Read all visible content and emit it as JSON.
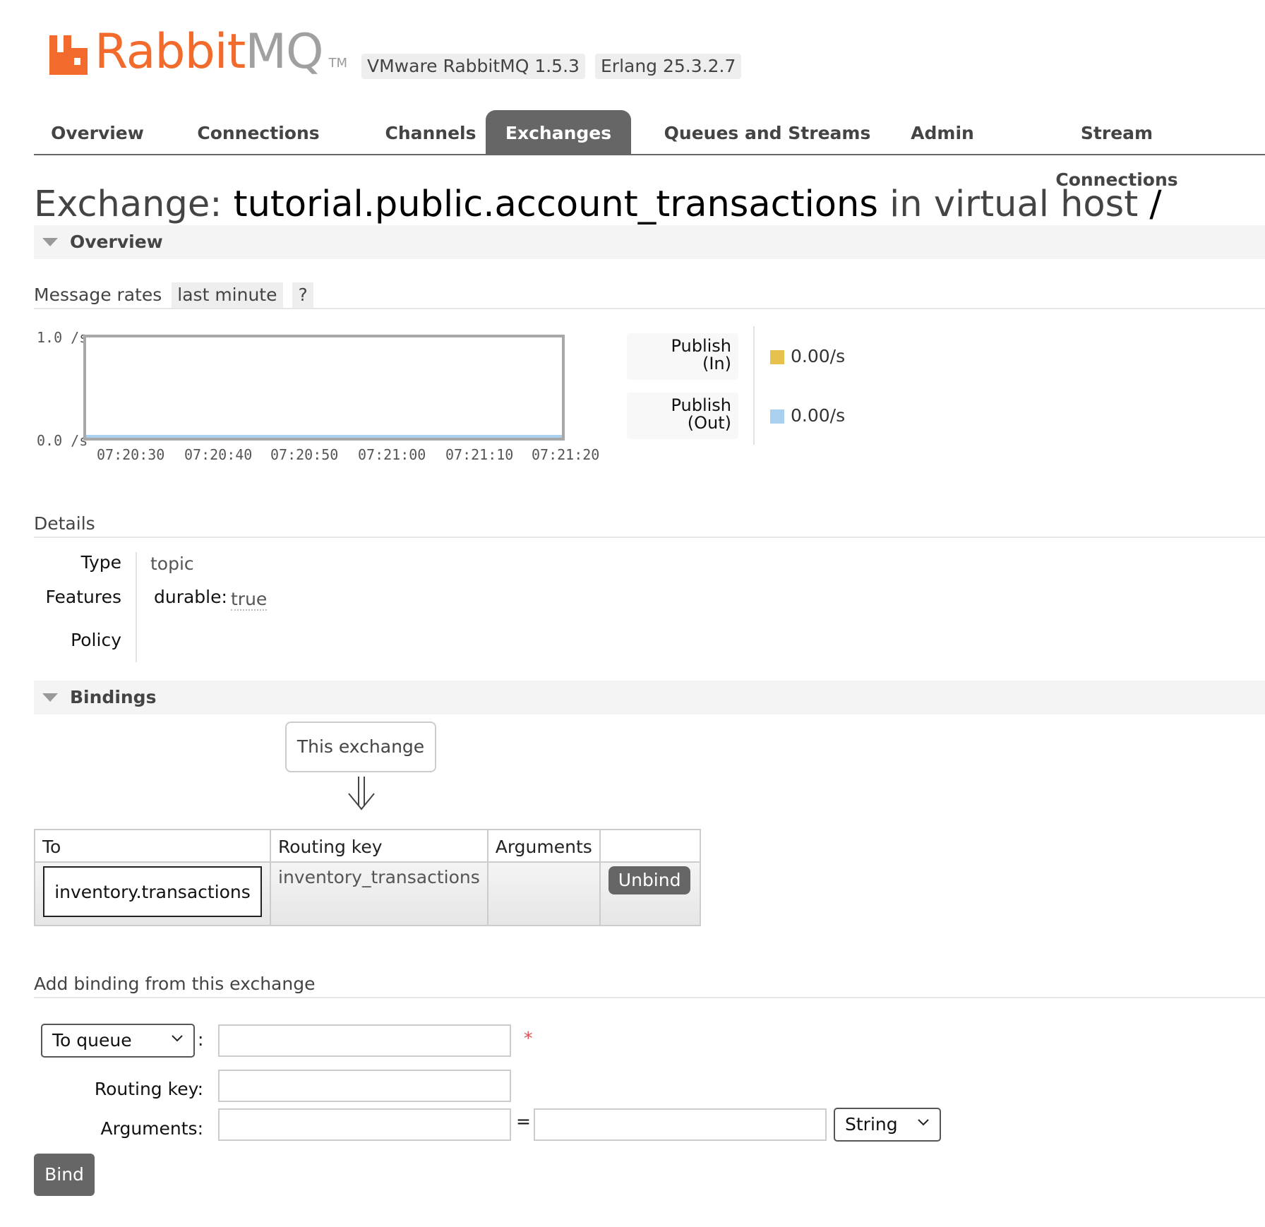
{
  "header": {
    "logo_rabbit": "Rabbit",
    "logo_mq": "MQ",
    "logo_tm": "TM",
    "version": "VMware RabbitMQ 1.5.3",
    "erlang": "Erlang 25.3.2.7"
  },
  "tabs": [
    {
      "label": "Overview",
      "active": false
    },
    {
      "label": "Connections",
      "active": false
    },
    {
      "label": "Channels",
      "active": false
    },
    {
      "label": "Exchanges",
      "active": true
    },
    {
      "label": "Queues and Streams",
      "active": false
    },
    {
      "label": "Admin",
      "active": false
    },
    {
      "label": "Stream Connections",
      "active": false
    }
  ],
  "title": {
    "prefix": "Exchange:",
    "name": "tutorial.public.account_transactions",
    "middle": "in virtual host",
    "vhost": "/"
  },
  "overview": {
    "section_label": "Overview",
    "message_rates_label": "Message rates",
    "range_chip": "last minute",
    "help_chip": "?",
    "legend": [
      {
        "label_line1": "Publish",
        "label_line2": "(In)",
        "value": "0.00/s",
        "color": "#e6c24d"
      },
      {
        "label_line1": "Publish",
        "label_line2": "(Out)",
        "value": "0.00/s",
        "color": "#aad0f0"
      }
    ]
  },
  "chart_data": {
    "type": "line",
    "x": [
      "07:20:30",
      "07:20:40",
      "07:20:50",
      "07:21:00",
      "07:21:10",
      "07:21:20"
    ],
    "y_ticks": [
      "1.0 /s",
      "0.0 /s"
    ],
    "ylim": [
      0,
      1
    ],
    "series": [
      {
        "name": "Publish (In)",
        "values": [
          0,
          0,
          0,
          0,
          0,
          0
        ],
        "color": "#e6c24d"
      },
      {
        "name": "Publish (Out)",
        "values": [
          0,
          0,
          0,
          0,
          0,
          0
        ],
        "color": "#aad0f0"
      }
    ]
  },
  "details": {
    "section_label": "Details",
    "type_label": "Type",
    "type_value": "topic",
    "features_label": "Features",
    "feature_key": "durable:",
    "feature_value": "true",
    "policy_label": "Policy"
  },
  "bindings": {
    "section_label": "Bindings",
    "this_exchange": "This exchange",
    "columns": [
      "To",
      "Routing key",
      "Arguments",
      ""
    ],
    "rows": [
      {
        "to": "inventory.transactions",
        "routing_key": "inventory_transactions",
        "arguments": "",
        "action": "Unbind"
      }
    ]
  },
  "add_binding": {
    "title": "Add binding from this exchange",
    "destination_select": "To queue",
    "required_marker": "*",
    "routing_key_label": "Routing key:",
    "arguments_label": "Arguments:",
    "equals": "=",
    "arg_type_select": "String",
    "bind_button": "Bind"
  }
}
